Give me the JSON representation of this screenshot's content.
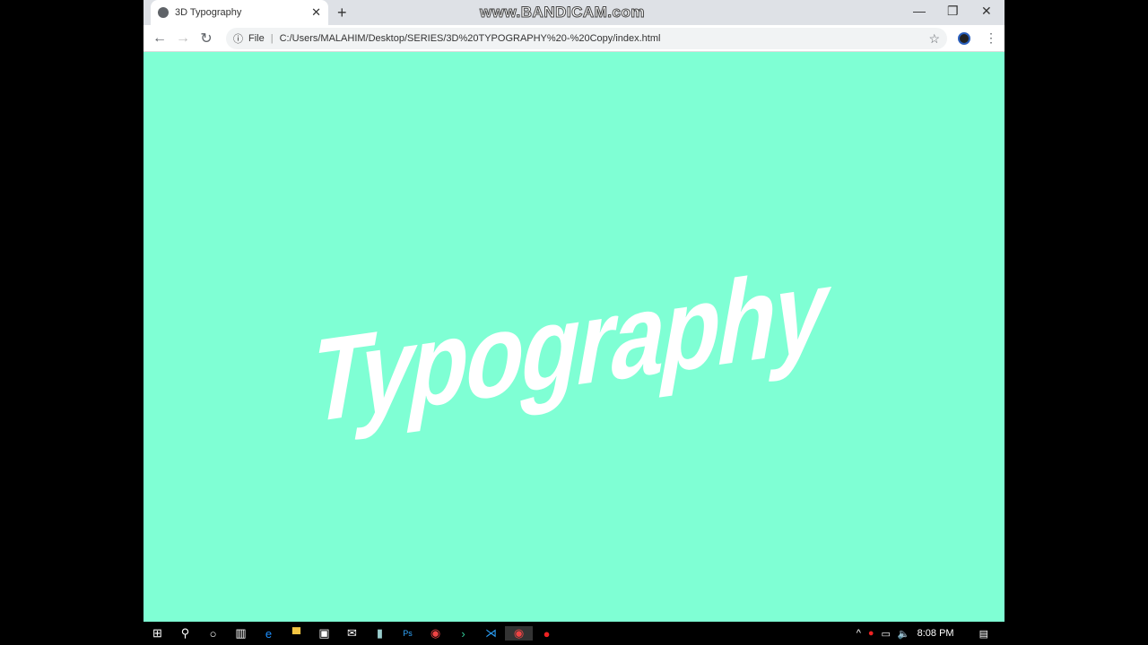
{
  "browser": {
    "tab_title": "3D Typography",
    "watermark": "www.BANDICAM.com",
    "address_prefix": "File",
    "url": "C:/Users/MALAHIM/Desktop/SERIES/3D%20TYPOGRAPHY%20-%20Copy/index.html"
  },
  "page": {
    "heading": "Typography",
    "background": "#7fffd4",
    "text_color": "#ffffff"
  },
  "taskbar": {
    "clock": "8:08 PM",
    "icons": [
      "windows-start",
      "search",
      "cortana",
      "task-view",
      "edge",
      "file-explorer",
      "store",
      "mail",
      "notepad",
      "photoshop",
      "chrome",
      "terminal",
      "vscode",
      "chrome-active",
      "bandicam-record"
    ]
  }
}
